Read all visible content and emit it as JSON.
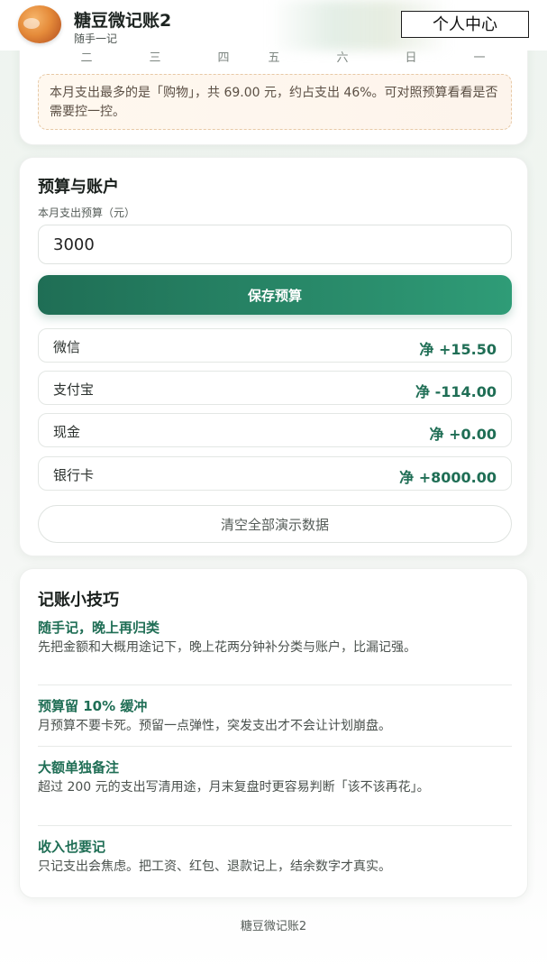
{
  "header": {
    "title": "糖豆微记账2",
    "subtitle": "随手一记",
    "profile_button": "个人中心"
  },
  "calendar": {
    "weekdays": [
      "二",
      "三",
      "四",
      "五",
      "六",
      "日",
      "一"
    ]
  },
  "insight": {
    "text": "本月支出最多的是「购物」，共 69.00 元，约占支出 46%。可对照预算看看是否需要控一控。"
  },
  "budget": {
    "section_title": "预算与账户",
    "label": "本月支出预算（元）",
    "value": "3000",
    "save_button": "保存预算",
    "accounts": [
      {
        "name": "微信",
        "net": "净 +15.50"
      },
      {
        "name": "支付宝",
        "net": "净 -114.00"
      },
      {
        "name": "现金",
        "net": "净 +0.00"
      },
      {
        "name": "银行卡",
        "net": "净 +8000.00"
      }
    ],
    "clear_button": "清空全部演示数据"
  },
  "tips": {
    "section_title": "记账小技巧",
    "items": [
      {
        "title": "随手记，晚上再归类",
        "body": "先把金额和大概用途记下，晚上花两分钟补分类与账户，比漏记强。"
      },
      {
        "title": "预算留 10% 缓冲",
        "body": "月预算不要卡死。预留一点弹性，突发支出才不会让计划崩盘。"
      },
      {
        "title": "大额单独备注",
        "body": "超过 200 元的支出写清用途，月末复盘时更容易判断「该不该再花」。"
      },
      {
        "title": "收入也要记",
        "body": "只记支出会焦虑。把工资、红包、退款记上，结余数字才真实。"
      }
    ]
  },
  "footer": {
    "text": "糖豆微记账2"
  },
  "colors": {
    "accent": "#1f6e55",
    "accent_light": "#2f9c77",
    "hint_border": "#e7c9a6"
  }
}
